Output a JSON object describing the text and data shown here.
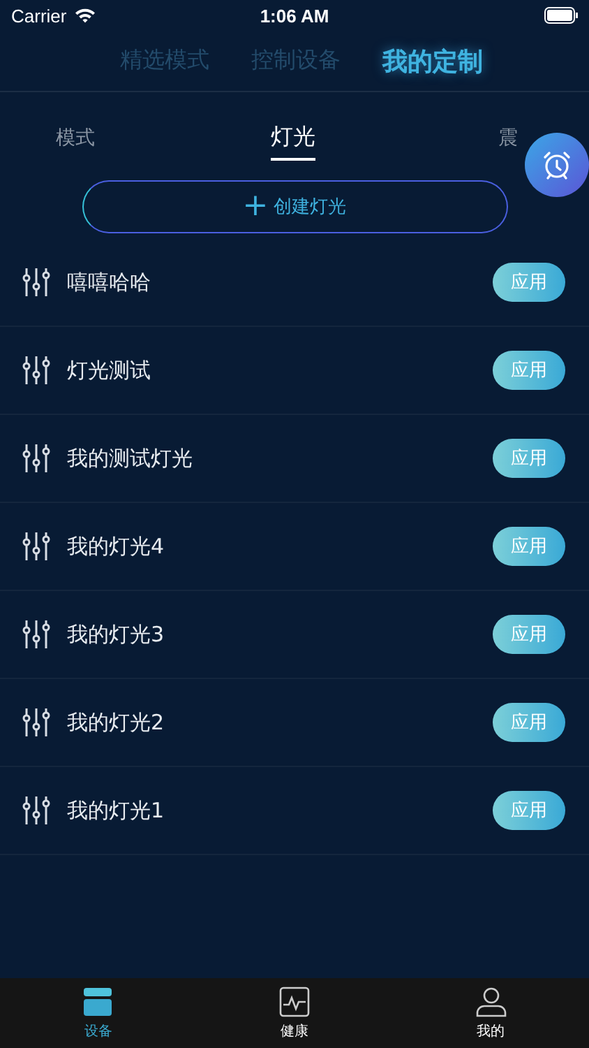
{
  "status_bar": {
    "carrier": "Carrier",
    "time": "1:06 AM"
  },
  "top_tabs": [
    {
      "label": "精选模式",
      "selected": false
    },
    {
      "label": "控制设备",
      "selected": false
    },
    {
      "label": "我的定制",
      "selected": true
    }
  ],
  "sub_tabs": [
    {
      "label": "模式",
      "selected": false
    },
    {
      "label": "灯光",
      "selected": true
    },
    {
      "label": "震",
      "selected": false
    }
  ],
  "create_button": {
    "icon": "+",
    "label": "创建灯光"
  },
  "items": [
    {
      "name": "嘻嘻哈哈",
      "action": "应用"
    },
    {
      "name": "灯光测试",
      "action": "应用"
    },
    {
      "name": "我的测试灯光",
      "action": "应用"
    },
    {
      "name": "我的灯光4",
      "action": "应用"
    },
    {
      "name": "我的灯光3",
      "action": "应用"
    },
    {
      "name": "我的灯光2",
      "action": "应用"
    },
    {
      "name": "我的灯光1",
      "action": "应用"
    }
  ],
  "bottom_tabs": [
    {
      "label": "设备",
      "kind": "device",
      "selected": true
    },
    {
      "label": "健康",
      "kind": "health",
      "selected": false
    },
    {
      "label": "我的",
      "kind": "profile",
      "selected": false
    }
  ]
}
